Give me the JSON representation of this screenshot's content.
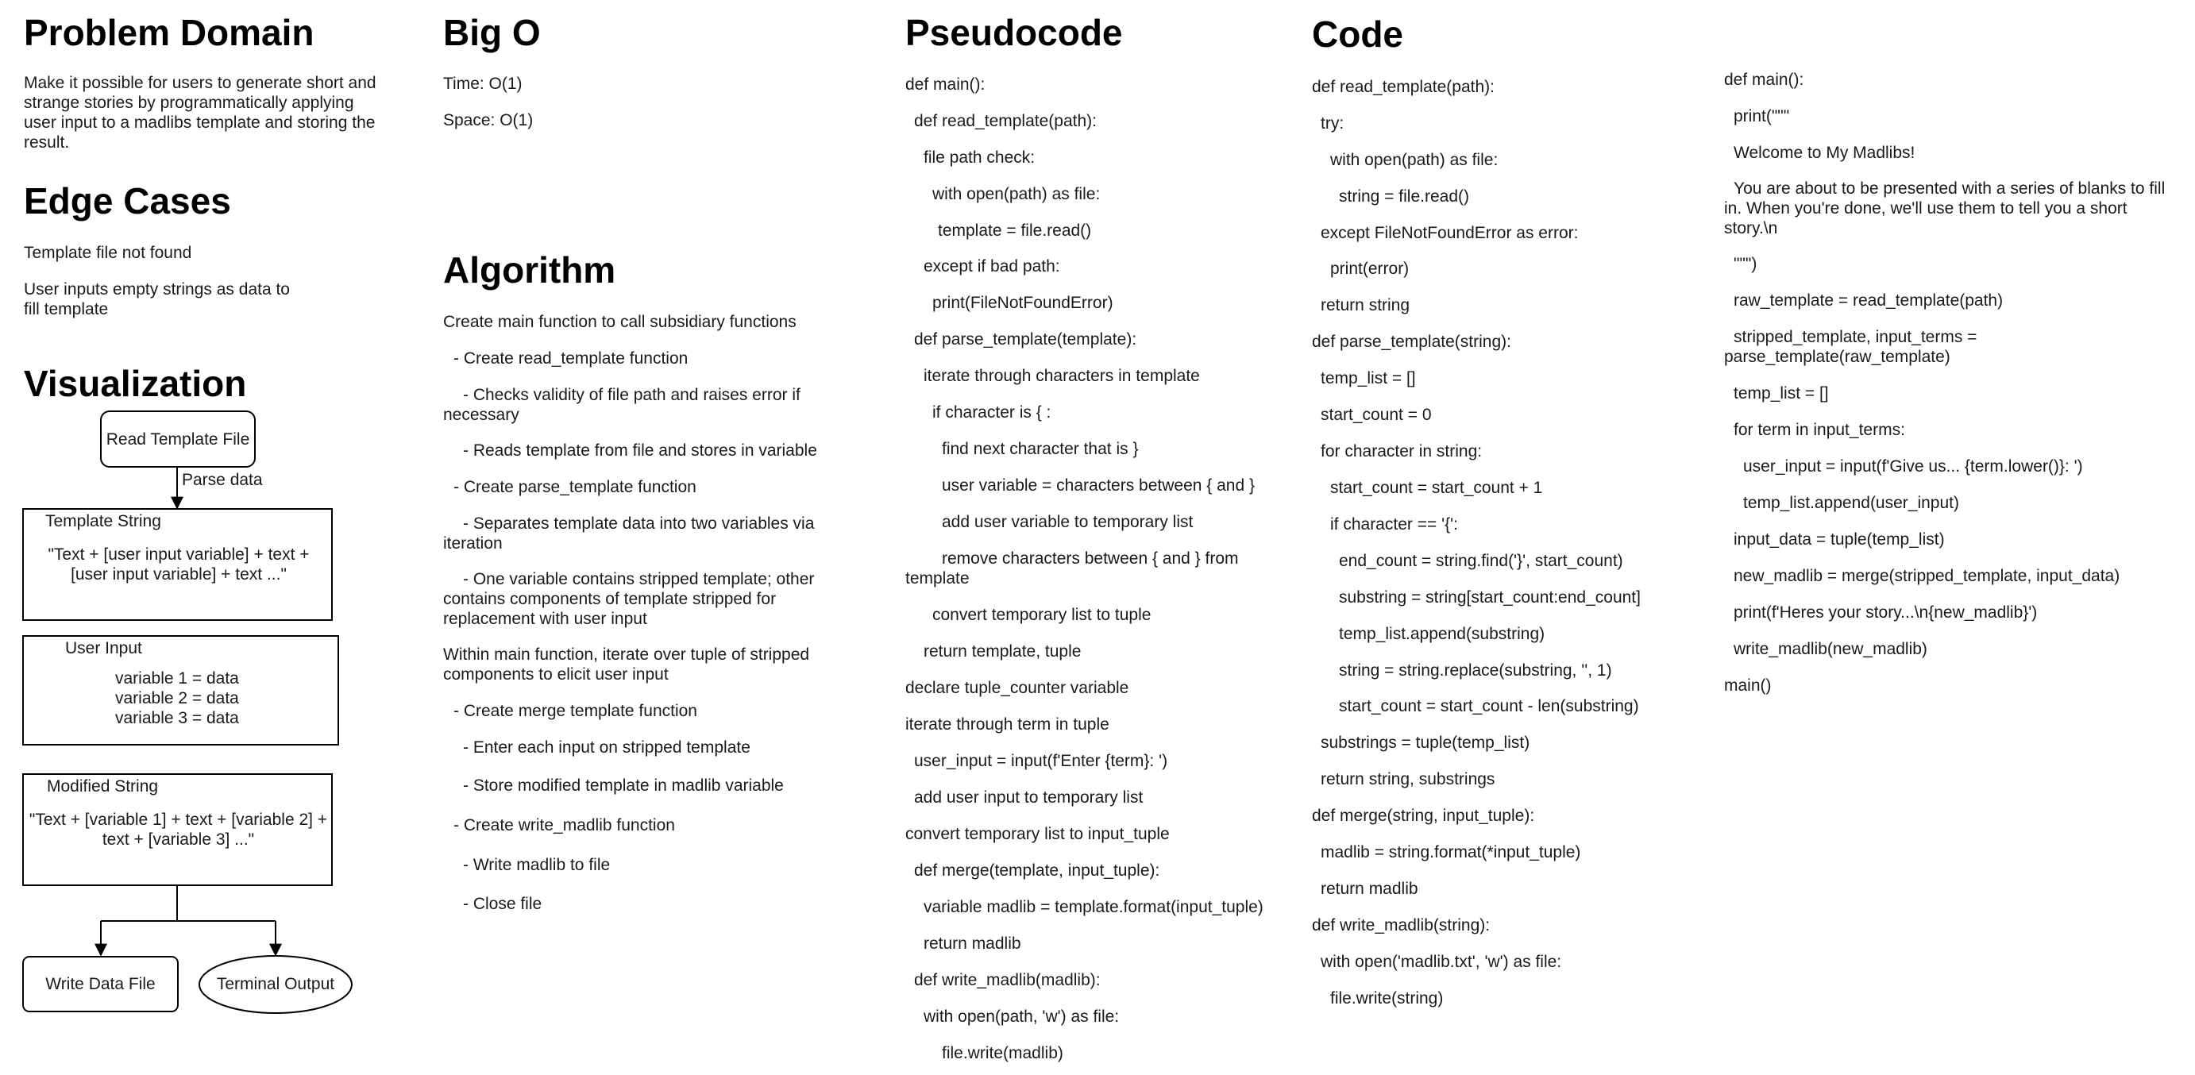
{
  "problem_domain": {
    "title": "Problem Domain",
    "text": "Make it possible for users to generate short and strange stories by programmatically applying user input to a madlibs template and storing the result."
  },
  "edge_cases": {
    "title": "Edge Cases",
    "items": [
      "Template file not found",
      "User inputs empty strings as data to fill template"
    ]
  },
  "visualization": {
    "title": "Visualization",
    "read_template": "Read Template File",
    "parse_label": "Parse data",
    "template_string_title": "Template String",
    "template_string_body": "\"Text + [user input variable] + text + [user input variable] + text ...\"",
    "user_input_title": "User Input",
    "user_input_lines": [
      "variable 1 = data",
      "variable 2 = data",
      "variable 3 = data"
    ],
    "modified_string_title": "Modified String",
    "modified_string_body": "\"Text + [variable 1] + text + [variable 2] + text + [variable 3] ...\"",
    "write_data_file": "Write Data File",
    "terminal_output": "Terminal Output"
  },
  "big_o": {
    "title": "Big O",
    "time": "Time: O(1)",
    "space": "Space: O(1)"
  },
  "algorithm": {
    "title": "Algorithm",
    "items": [
      "Create main function to call subsidiary functions",
      "- Create read_template function",
      "- Checks validity of file path and raises error if necessary",
      "- Reads template from file and stores in variable",
      "- Create parse_template function",
      "- Separates template data into two variables via iteration",
      "- One variable contains stripped template; other contains components of template stripped for replacement with user input",
      "Within main function, iterate over tuple of stripped components to elicit user input",
      "- Create merge template function",
      "- Enter each input on stripped template",
      "- Store modified template in madlib variable",
      "- Create write_madlib function",
      "- Write madlib to file",
      "- Close file"
    ]
  },
  "pseudocode": {
    "title": "Pseudocode",
    "lines": [
      "def main():",
      "def read_template(path):",
      "file path check:",
      "with open(path) as file:",
      "template = file.read()",
      "except if bad path:",
      "print(FileNotFoundError)",
      "def parse_template(template):",
      "iterate through characters in template",
      "if character is { :",
      "find next character that is }",
      "user variable = characters between { and }",
      "add user variable to temporary list",
      "remove characters between { and } from template",
      "convert temporary list to tuple",
      "return template, tuple",
      "declare tuple_counter variable",
      "iterate through term in tuple",
      "user_input = input(f'Enter {term}: ')",
      "add user input to temporary list",
      "convert temporary list to input_tuple",
      "def merge(template, input_tuple):",
      "variable madlib = template.format(input_tuple)",
      "return madlib",
      "def write_madlib(madlib):",
      "with open(path, 'w') as file:",
      "file.write(madlib)"
    ]
  },
  "code": {
    "title": "Code",
    "lines": [
      "def read_template(path):",
      "try:",
      "with open(path) as file:",
      "string = file.read()",
      "except FileNotFoundError as error:",
      "print(error)",
      "return string",
      "def parse_template(string):",
      "temp_list = []",
      "start_count = 0",
      "for character in string:",
      "start_count = start_count + 1",
      "if character == '{':",
      "end_count = string.find('}', start_count)",
      "substring = string[start_count:end_count]",
      "temp_list.append(substring)",
      "string = string.replace(substring, '', 1)",
      "start_count = start_count - len(substring)",
      "substrings = tuple(temp_list)",
      "return string, substrings",
      "def merge(string, input_tuple):",
      "madlib = string.format(*input_tuple)",
      "return madlib",
      "def write_madlib(string):",
      "with open('madlib.txt', 'w') as file:",
      "file.write(string)"
    ],
    "main_lines": [
      "def main():",
      "print(\"\"\"",
      "Welcome to My Madlibs!",
      "You are about to be presented with a series of blanks to fill in. When you're done, we'll use them to tell you a short story.\\n",
      "\"\"\")",
      "raw_template = read_template(path)",
      "stripped_template, input_terms = parse_template(raw_template)",
      "temp_list = []",
      "for term in input_terms:",
      "user_input = input(f'Give us... {term.lower()}: ')",
      "temp_list.append(user_input)",
      "input_data = tuple(temp_list)",
      "new_madlib = merge(stripped_template, input_data)",
      "print(f'Heres your story...\\n{new_madlib}')",
      "write_madlib(new_madlib)",
      "main()"
    ]
  }
}
